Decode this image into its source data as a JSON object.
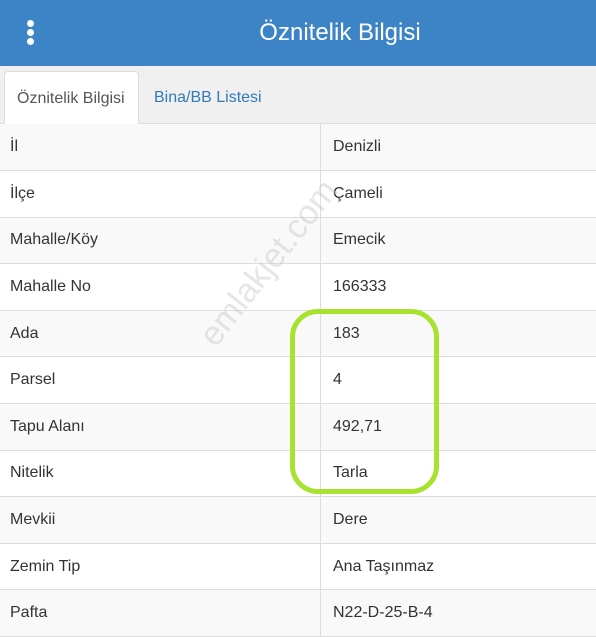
{
  "header": {
    "title": "Öznitelik Bilgisi",
    "menu_icon": "kebab-menu-icon"
  },
  "tabs": [
    {
      "label": "Öznitelik Bilgisi",
      "active": true
    },
    {
      "label": "Bina/BB Listesi",
      "active": false
    }
  ],
  "rows": [
    {
      "key": "İl",
      "value": "Denizli"
    },
    {
      "key": "İlçe",
      "value": "Çameli"
    },
    {
      "key": "Mahalle/Köy",
      "value": "Emecik"
    },
    {
      "key": "Mahalle No",
      "value": "166333"
    },
    {
      "key": "Ada",
      "value": "183"
    },
    {
      "key": "Parsel",
      "value": "4"
    },
    {
      "key": "Tapu Alanı",
      "value": "492,71"
    },
    {
      "key": "Nitelik",
      "value": "Tarla"
    },
    {
      "key": "Mevkii",
      "value": "Dere"
    },
    {
      "key": "Zemin Tip",
      "value": "Ana Taşınmaz"
    },
    {
      "key": "Pafta",
      "value": "N22-D-25-B-4"
    }
  ],
  "watermark": "emlakjet.com",
  "colors": {
    "header": "#3d84c6",
    "link": "#337ab7",
    "highlight": "#a6e22e"
  }
}
